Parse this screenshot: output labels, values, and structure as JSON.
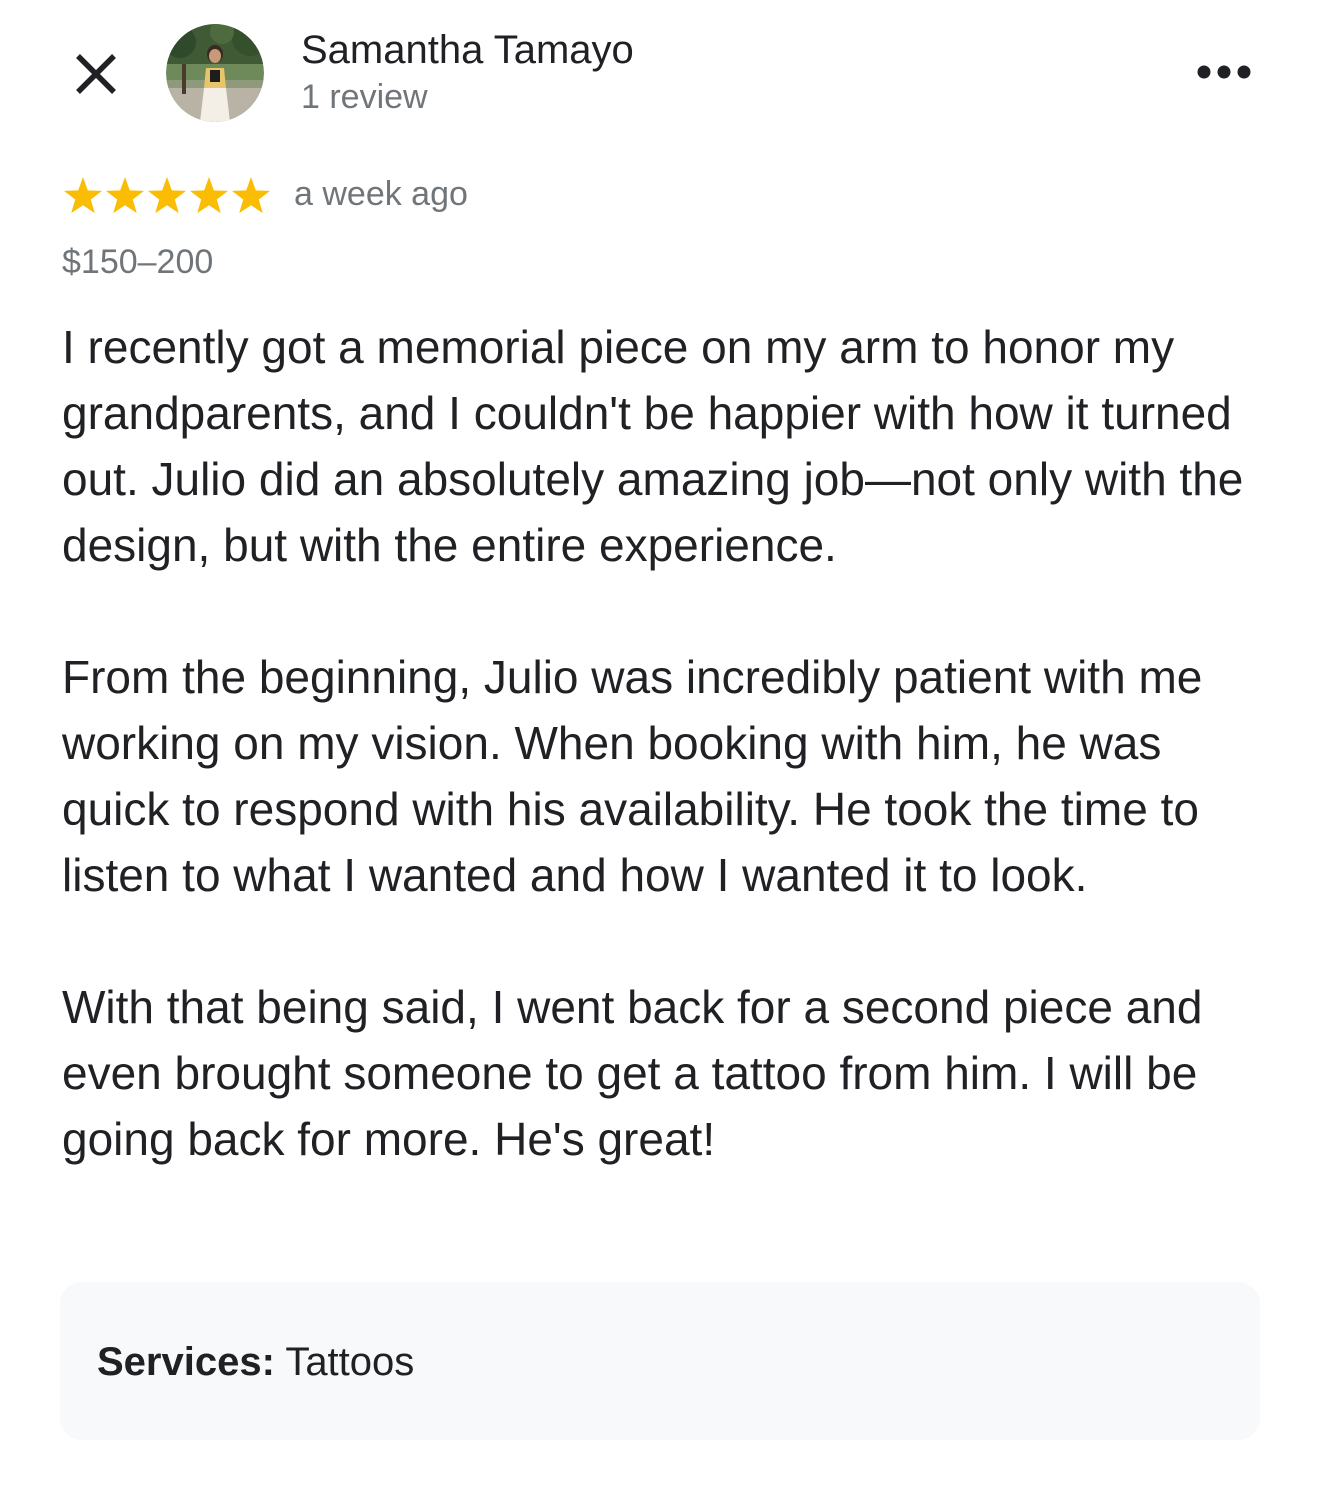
{
  "header": {
    "reviewer_name": "Samantha Tamayo",
    "review_count": "1 review",
    "close_icon": "close-icon",
    "more_icon": "more-horizontal-icon"
  },
  "review": {
    "rating": 5,
    "rating_max": 5,
    "star_color": "#fbbc04",
    "time_ago": "a week ago",
    "price": "$150–200",
    "paragraphs": [
      "I recently got a memorial piece on my arm to honor my grandparents, and I couldn't be happier with how it turned out. Julio did an absolutely amazing job—not only with the design, but with the entire experience.",
      "From the beginning, Julio was incredibly patient with me working on my vision. When booking with him, he was quick to respond with his availability. He took the time to listen to what I wanted and how I wanted it to look.",
      "With that being said, I went back for a second piece and even brought someone to get a tattoo from him. I will be going back for more. He's great!"
    ]
  },
  "services": {
    "label": "Services:",
    "value": "Tattoos"
  },
  "colors": {
    "text_primary": "#202124",
    "text_secondary": "#70757a",
    "services_bg": "#f8f9fa"
  }
}
